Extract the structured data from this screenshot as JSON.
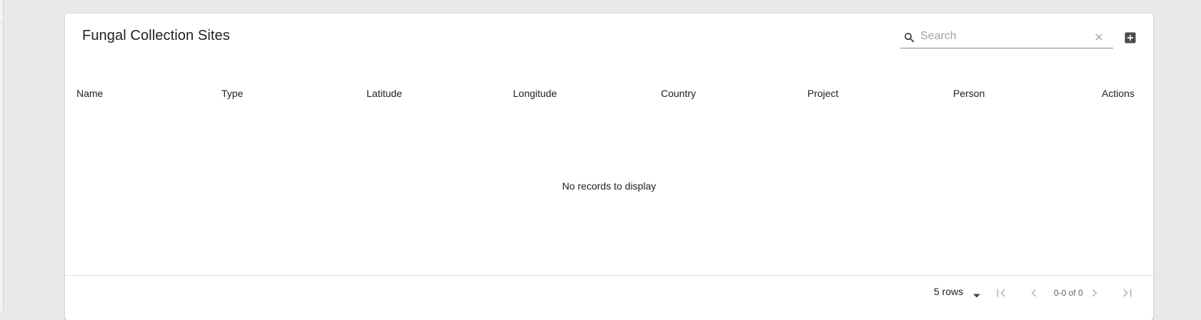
{
  "table": {
    "title": "Fungal Collection Sites",
    "search": {
      "placeholder": "Search",
      "value": ""
    },
    "columns": [
      "Name",
      "Type",
      "Latitude",
      "Longitude",
      "Country",
      "Project",
      "Person",
      "Actions"
    ],
    "rows": [],
    "empty_message": "No records to display"
  },
  "pagination": {
    "rows_per_page": "5 rows",
    "range_label": "0-0 of 0"
  },
  "icons": {
    "search": "search-icon",
    "clear": "close-icon",
    "add": "add-box-icon",
    "dropdown": "arrow-drop-down-icon",
    "first": "first-page-icon",
    "prev": "chevron-left-icon",
    "next": "chevron-right-icon",
    "last": "last-page-icon"
  },
  "colors": {
    "background": "#e9e9e9",
    "card": "#ffffff",
    "text": "#212121",
    "icon": "#616161",
    "disabled_icon": "#bdbdbd"
  }
}
